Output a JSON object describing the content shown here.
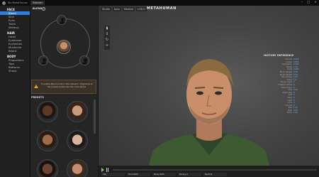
{
  "titlebar": {
    "tab": "My MetaHuman",
    "project": "Blender"
  },
  "nav": {
    "sections": [
      {
        "title": "FACE",
        "items": [
          "Blend",
          "Skin",
          "Eyes",
          "Teeth",
          "Makeup"
        ],
        "active": 0
      },
      {
        "title": "HAIR",
        "items": [
          "Head",
          "Eyebrows",
          "Eyelashes",
          "Mustache",
          "Beard"
        ]
      },
      {
        "title": "BODY",
        "items": [
          "Proportions",
          "Tops",
          "Bottoms",
          "Shoes"
        ]
      }
    ]
  },
  "blend": {
    "title": "BLEND",
    "warning": "To enable Blend mode in the viewport, drag three of the presets below into the circle above"
  },
  "presets": {
    "title": "PRESETS"
  },
  "viewport": {
    "brand": "METAHUMAN",
    "chips": [
      "Studio",
      "Auto",
      "Medium",
      "LOD 0"
    ],
    "reference": {
      "title": "HISTORY REFERENCE",
      "rows": [
        {
          "k": "Portrait",
          "v": "0.000"
        },
        {
          "k": "Crease",
          "v": "0.000"
        },
        {
          "k": "Expression",
          "v": "0.000"
        },
        {
          "k": "Shape",
          "v": "1.00"
        },
        {
          "k": "Scale",
          "v": "0.000"
        },
        {
          "k": "Blend Weight",
          "v": "0.50"
        },
        {
          "k": "Blend Weight",
          "v": "0.54"
        },
        {
          "k": "Face Shape",
          "v": "1.00"
        },
        {
          "k": "Slider",
          "v": "1.0"
        },
        {
          "k": "Shape Layer",
          "v": "0"
        },
        {
          "k": "Freeform Mode",
          "v": "0"
        },
        {
          "k": "Face Colour",
          "v": "0"
        },
        {
          "k": "Unlit",
          "v": "Unlit"
        },
        {
          "k": "Sharpness",
          "v": "0"
        },
        {
          "k": "Soft",
          "v": "0"
        },
        {
          "k": "Dark",
          "v": "0"
        },
        {
          "k": "Light",
          "v": "0"
        },
        {
          "k": "Lens",
          "v": "0"
        },
        {
          "k": "Volume",
          "v": "0"
        },
        {
          "k": "Size",
          "v": "1.00"
        },
        {
          "k": "Bias",
          "v": "0.00"
        },
        {
          "k": "Body",
          "v": "1.00"
        }
      ]
    },
    "bottom": [
      "Idle",
      "Face ROM",
      "Body ROM",
      "Posing A",
      "Neutral"
    ]
  },
  "colors": {
    "accent": "#2f7fd6",
    "warning": "#e3a41b",
    "value": "#6cb6ff",
    "play": "#6fcf5a"
  }
}
